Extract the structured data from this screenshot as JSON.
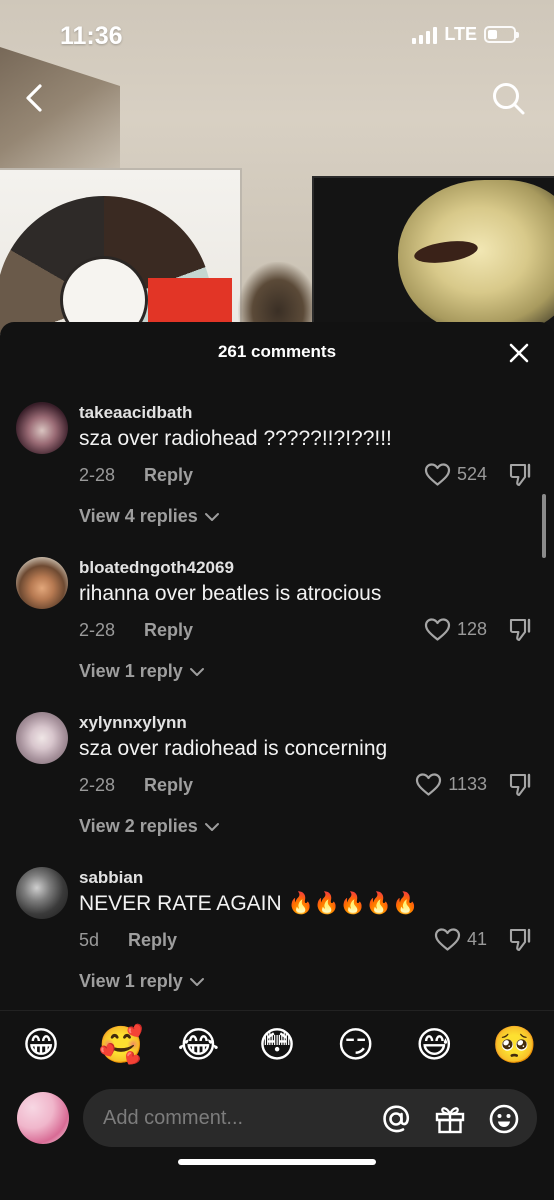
{
  "status_bar": {
    "time": "11:36",
    "network": "LTE"
  },
  "comments_panel": {
    "title": "261 comments",
    "comments": [
      {
        "username": "takeaacidbath",
        "text": "sza over radiohead ?????!!?!??!!!",
        "date": "2-28",
        "reply_label": "Reply",
        "likes": "524",
        "view_replies": "View 4 replies"
      },
      {
        "username": "bloatedngoth42069",
        "text": "rihanna over beatles is atrocious",
        "date": "2-28",
        "reply_label": "Reply",
        "likes": "128",
        "view_replies": "View 1 reply"
      },
      {
        "username": "xylynnxylynn",
        "text": "sza over radiohead is concerning",
        "date": "2-28",
        "reply_label": "Reply",
        "likes": "1133",
        "view_replies": "View 2 replies"
      },
      {
        "username": "sabbian",
        "text": "NEVER RATE AGAIN 🔥🔥🔥🔥🔥",
        "date": "5d",
        "reply_label": "Reply",
        "likes": "41",
        "view_replies": "View 1 reply"
      }
    ]
  },
  "emoji_bar": [
    "😁",
    "🥰",
    "😂",
    "😳",
    "😏",
    "😅",
    "🥺"
  ],
  "comment_input": {
    "placeholder": "Add comment..."
  },
  "colors": {
    "sheet_bg": "#121212",
    "muted_text": "#9a9a9a",
    "input_bg": "#2a2a2a"
  }
}
